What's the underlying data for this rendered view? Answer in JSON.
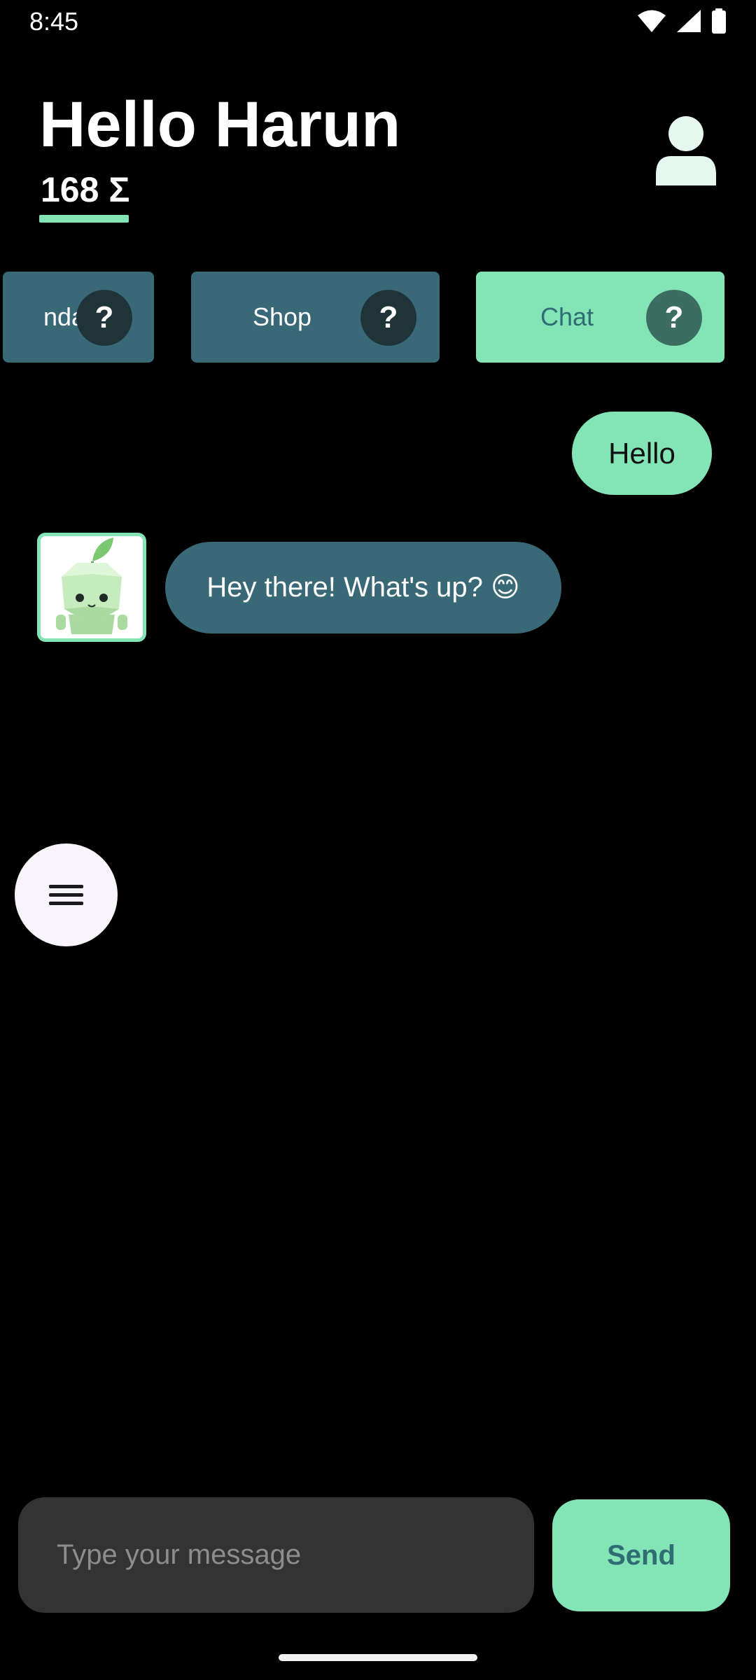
{
  "status_bar": {
    "time": "8:45",
    "icons": [
      "wifi-icon",
      "cellular-signal-icon",
      "battery-icon"
    ]
  },
  "header": {
    "greeting": "Hello Harun",
    "points": "168 Σ",
    "profile_icon": "user-profile-icon"
  },
  "tabs": [
    {
      "label": "ndar",
      "help": "?",
      "active": false
    },
    {
      "label": "Shop",
      "help": "?",
      "active": false
    },
    {
      "label": "Chat",
      "help": "?",
      "active": true
    }
  ],
  "messages": [
    {
      "sender": "user",
      "text": "Hello"
    },
    {
      "sender": "bot",
      "text": "Hey there! What's up? 😊",
      "avatar": "robot-sprout-avatar"
    }
  ],
  "menu_button": {
    "icon": "hamburger-menu-icon"
  },
  "composer": {
    "placeholder": "Type your message",
    "value": "",
    "send_label": "Send"
  },
  "colors": {
    "accent_green": "#83e4b6",
    "tab_teal": "#396977",
    "help_dark": "#1e3439",
    "chat_text": "#2f6c74",
    "input_bg": "#333333",
    "background": "#000000"
  }
}
